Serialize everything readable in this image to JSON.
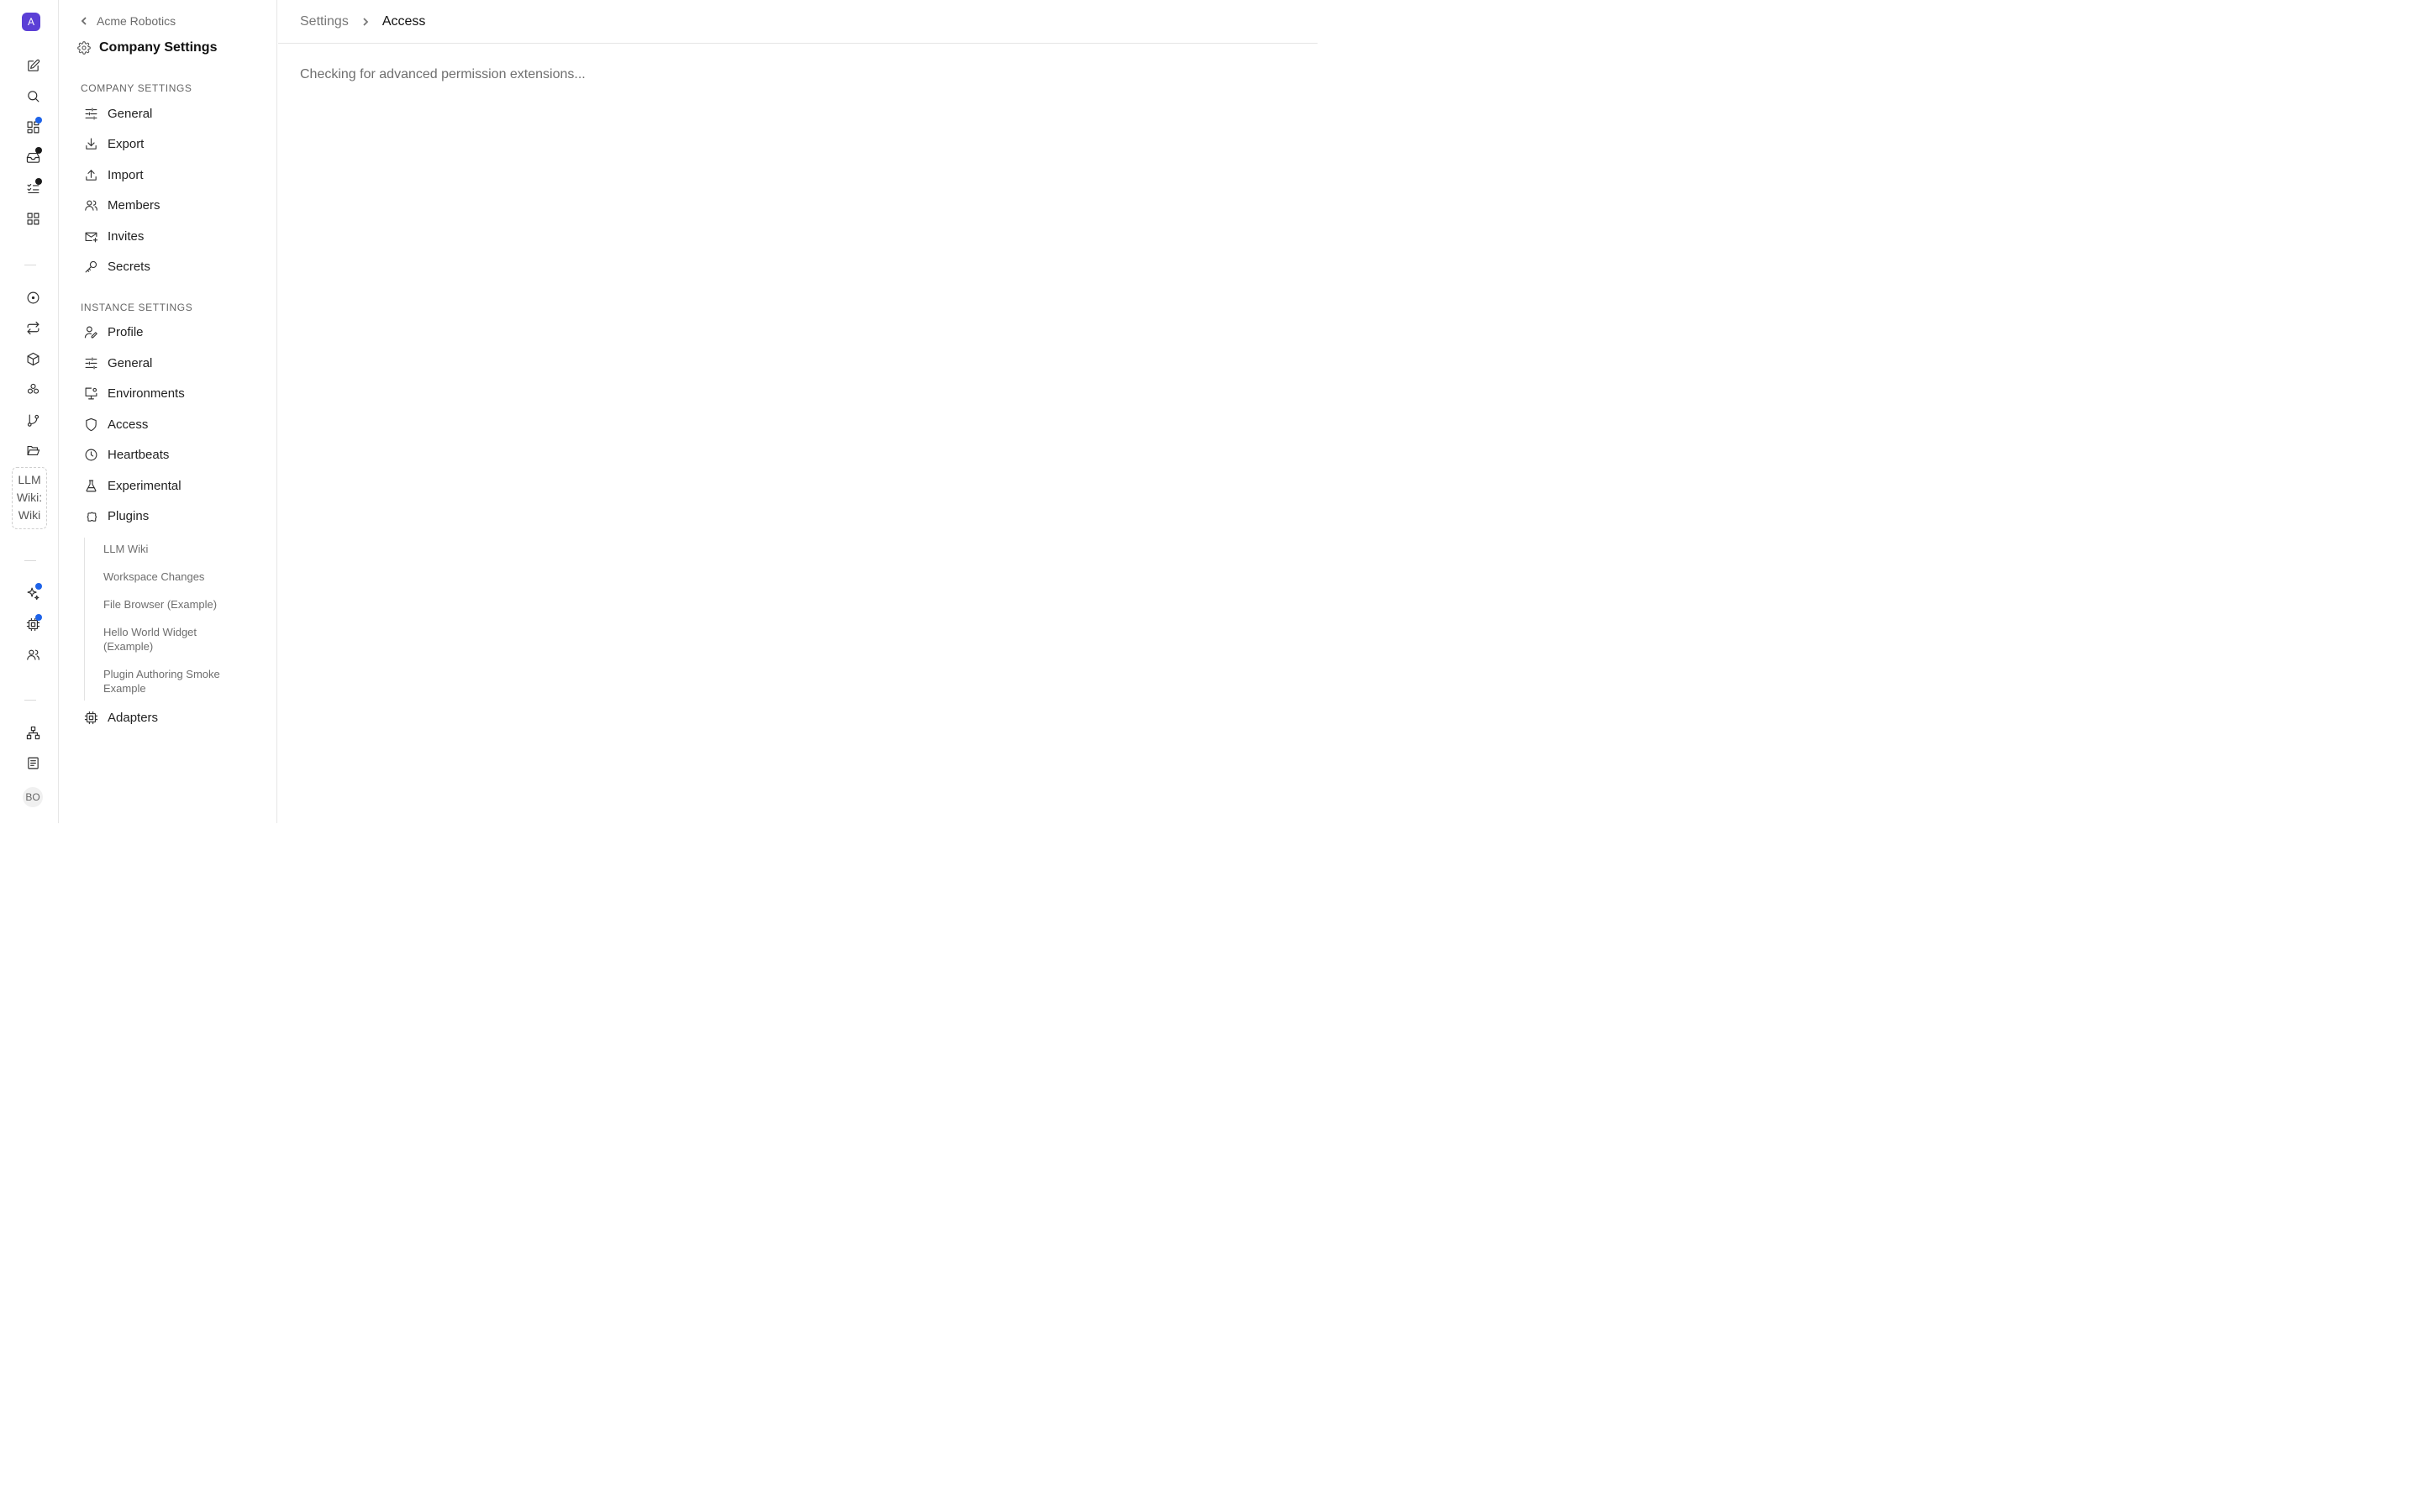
{
  "rail": {
    "logo_letter": "A",
    "wiki_label": "LLM\nWiki:\nWiki",
    "avatar_initials": "BO",
    "dot_blue": "#1e63e9",
    "dot_dark": "#1c1c1c"
  },
  "sidebar": {
    "back_label": "Acme Robotics",
    "title": "Company Settings",
    "company_heading": "COMPANY SETTINGS",
    "company_items": [
      {
        "label": "General",
        "icon": "sliders-icon"
      },
      {
        "label": "Export",
        "icon": "download-icon"
      },
      {
        "label": "Import",
        "icon": "upload-icon"
      },
      {
        "label": "Members",
        "icon": "users-icon"
      },
      {
        "label": "Invites",
        "icon": "mail-plus-icon"
      },
      {
        "label": "Secrets",
        "icon": "key-icon"
      }
    ],
    "instance_heading": "INSTANCE SETTINGS",
    "instance_items": [
      {
        "label": "Profile",
        "icon": "user-pen-icon"
      },
      {
        "label": "General",
        "icon": "sliders-icon"
      },
      {
        "label": "Environments",
        "icon": "monitor-cog-icon"
      },
      {
        "label": "Access",
        "icon": "shield-icon"
      },
      {
        "label": "Heartbeats",
        "icon": "clock-icon"
      },
      {
        "label": "Experimental",
        "icon": "flask-icon"
      },
      {
        "label": "Plugins",
        "icon": "puzzle-icon"
      }
    ],
    "plugin_subitems": [
      "LLM Wiki",
      "Workspace Changes",
      "File Browser (Example)",
      "Hello World Widget (Example)",
      "Plugin Authoring Smoke Example"
    ],
    "adapters_label": "Adapters"
  },
  "main": {
    "breadcrumb_root": "Settings",
    "breadcrumb_current": "Access",
    "status_text": "Checking for advanced permission extensions..."
  }
}
